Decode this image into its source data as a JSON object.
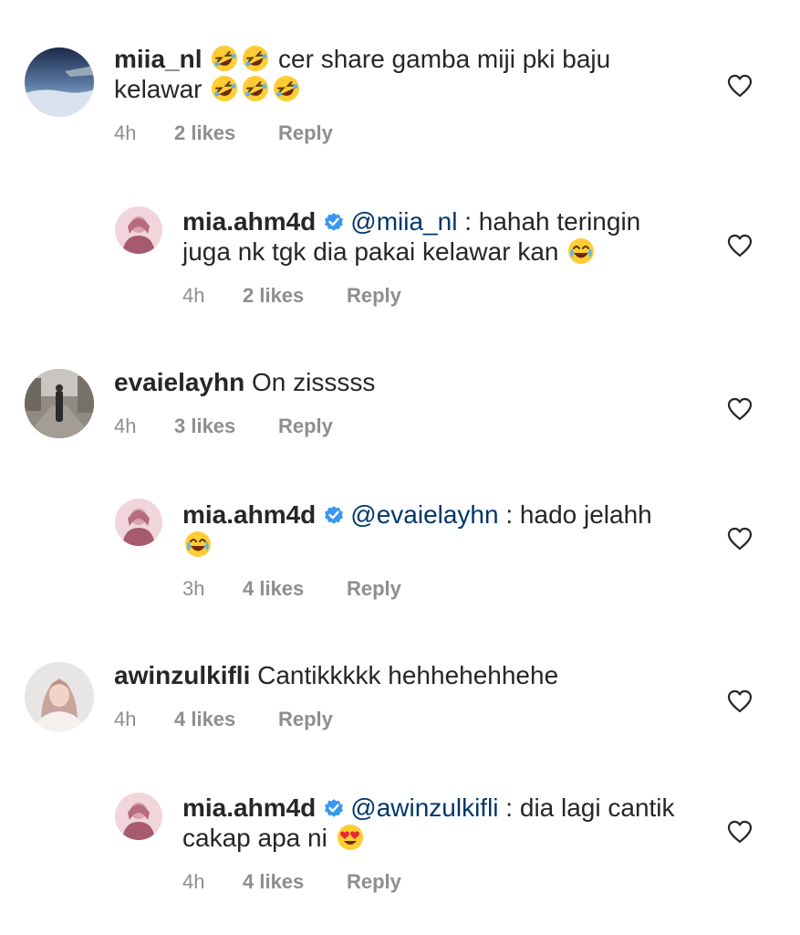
{
  "comments": [
    {
      "username": "miia_nl",
      "text_before": "",
      "text_after": " cer share gamba miji pki baju kelawar ",
      "lead_emojis": [
        "rofl-emoji",
        "rofl-emoji"
      ],
      "trail_emojis": [
        "rofl-emoji",
        "rofl-emoji",
        "rofl-emoji"
      ],
      "time": "4h",
      "likes": "2 likes",
      "reply_label": "Reply"
    },
    {
      "username": "mia.ahm4d",
      "verified": true,
      "mention": "@miia_nl",
      "text": " : hahah teringin juga nk tgk dia pakai kelawar kan ",
      "trail_emojis": [
        "tears-of-joy-emoji"
      ],
      "time": "4h",
      "likes": "2 likes",
      "reply_label": "Reply"
    },
    {
      "username": "evaielayhn",
      "text": "On zisssss",
      "time": "4h",
      "likes": "3 likes",
      "reply_label": "Reply"
    },
    {
      "username": "mia.ahm4d",
      "verified": true,
      "mention": "@evaielayhn",
      "text": " : hado jelahh ",
      "trail_emojis": [
        "tears-of-joy-emoji"
      ],
      "time": "3h",
      "likes": "4 likes",
      "reply_label": "Reply"
    },
    {
      "username": "awinzulkifli",
      "text": "Cantikkkkk hehhehehhehe",
      "time": "4h",
      "likes": "4 likes",
      "reply_label": "Reply"
    },
    {
      "username": "mia.ahm4d",
      "verified": true,
      "mention": "@awinzulkifli",
      "text": " : dia lagi cantik cakap apa ni ",
      "trail_emojis": [
        "heart-eyes-emoji"
      ],
      "time": "4h",
      "likes": "4 likes",
      "reply_label": "Reply"
    }
  ],
  "icons": {
    "like": "heart-outline-icon",
    "verified": "verified-badge-icon"
  },
  "colors": {
    "text": "#262626",
    "meta": "#8e8e8e",
    "mention": "#00376b",
    "verified": "#3897f0"
  }
}
